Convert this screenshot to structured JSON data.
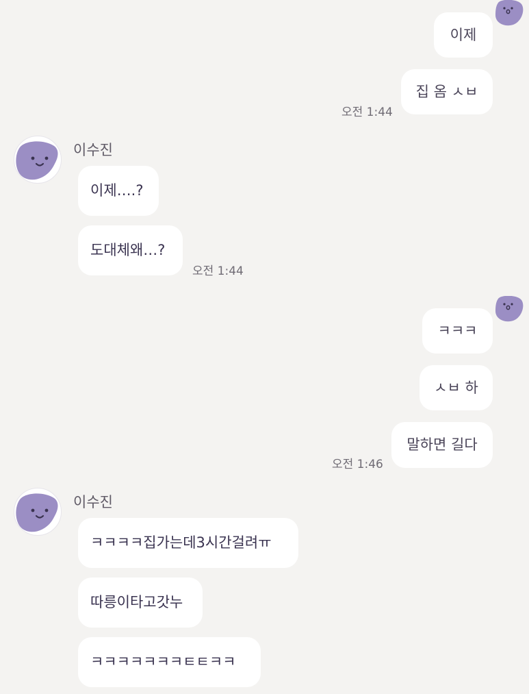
{
  "chat": {
    "partner_name": "이수진",
    "blocks": [
      {
        "sender": "me",
        "messages": [
          "이제",
          "집 옴 ㅅㅂ"
        ],
        "time": "오전 1:44"
      },
      {
        "sender": "partner",
        "name": "이수진",
        "messages": [
          "이제….?",
          "도대체왜…?"
        ],
        "time": "오전 1:44"
      },
      {
        "sender": "me",
        "messages": [
          "ㅋㅋㅋ",
          "ㅅㅂ 하",
          "말하면 길다"
        ],
        "time": "오전 1:46"
      },
      {
        "sender": "partner",
        "name": "이수진",
        "messages": [
          "ㅋㅋㅋㅋ집가는데3시간걸려ㅠ",
          "따릉이타고갓누",
          "ㅋㅋㅋㅋㅋㅋㅋㅌㅌㅋㅋ"
        ]
      }
    ]
  },
  "colors": {
    "background": "#f4f3f1",
    "bubble": "#ffffff",
    "avatar_purple": "#9b8ec4"
  },
  "icons": {
    "my_avatar": "purple-blob-face-icon",
    "partner_avatar": "purple-blob-smile-icon"
  }
}
